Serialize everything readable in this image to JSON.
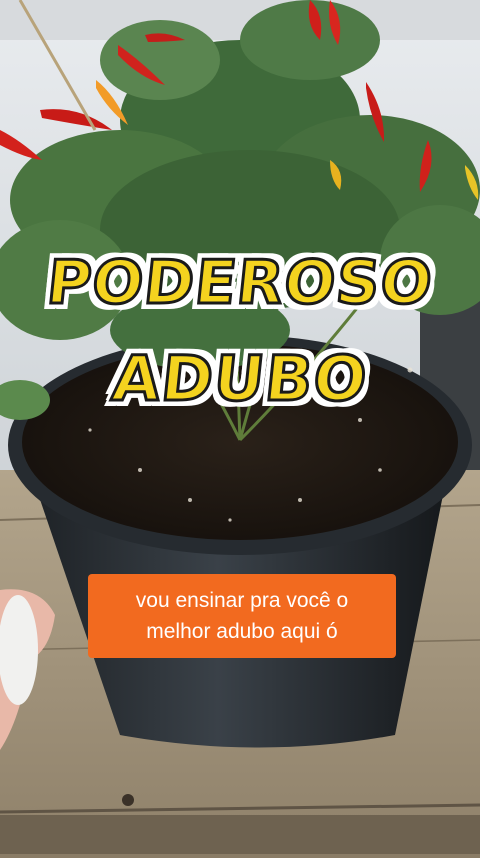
{
  "headline": {
    "line1": "PODEROSO",
    "line2": "ADUBO"
  },
  "caption": {
    "line1": "vou ensinar pra você o",
    "line2": "melhor adubo aqui ó"
  },
  "colors": {
    "headline_fill": "#f4d31f",
    "headline_outline": "#1a1a1a",
    "caption_background": "#f26a1f",
    "caption_text": "#ffffff"
  }
}
